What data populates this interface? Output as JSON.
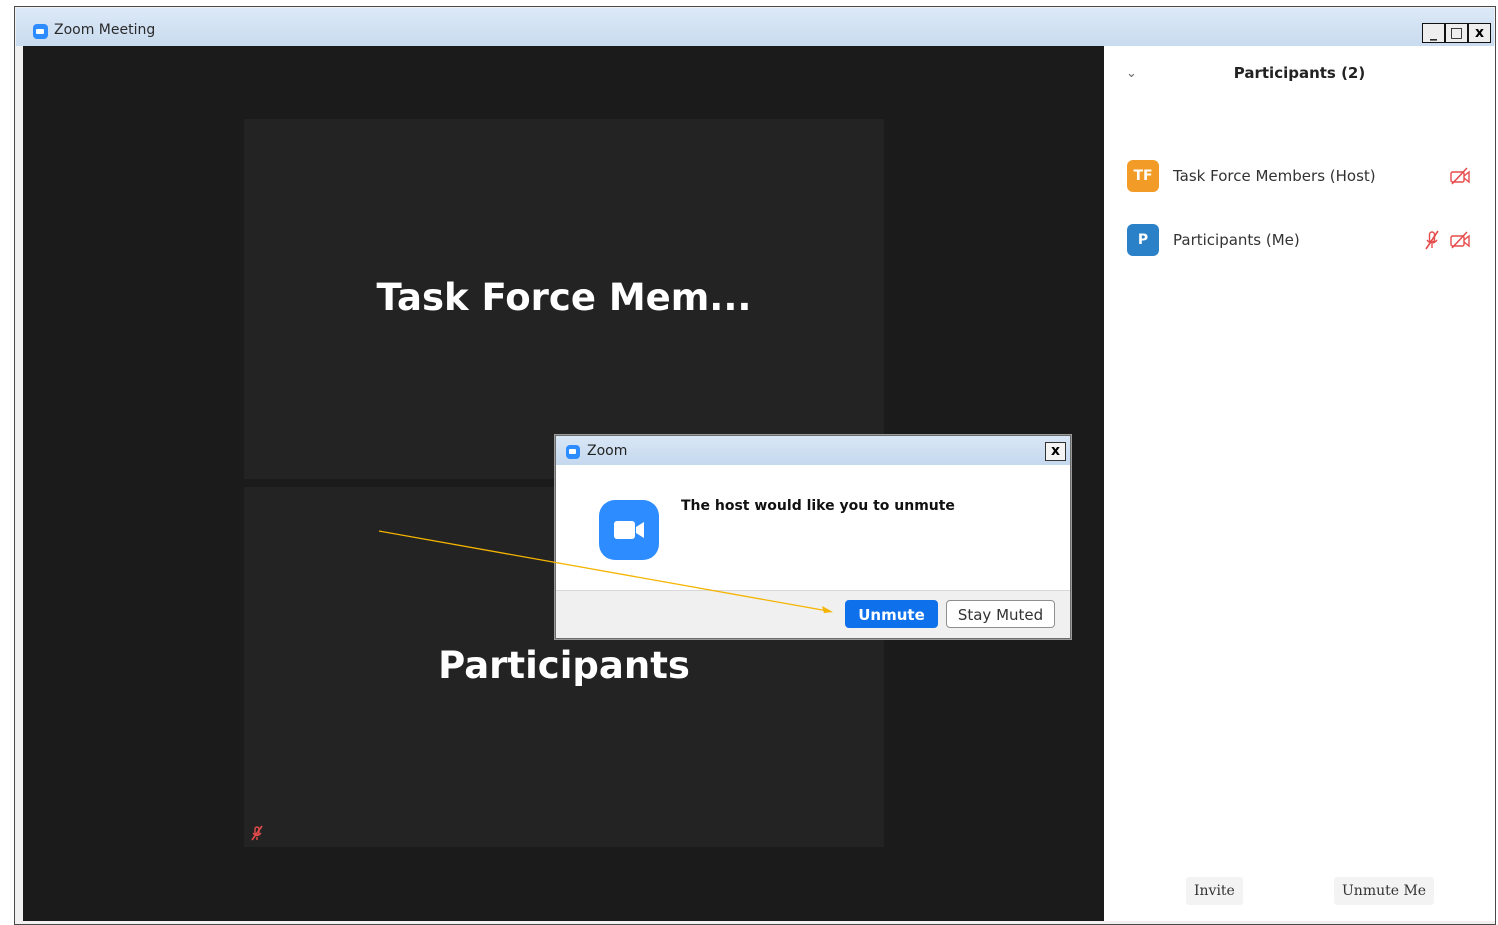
{
  "window": {
    "title": "Zoom Meeting",
    "controls": [
      "_",
      "□",
      "x"
    ]
  },
  "video": {
    "tiles": [
      {
        "name": "Task Force Mem..."
      },
      {
        "name": "Participants",
        "muted": true
      }
    ]
  },
  "panel": {
    "title": "Participants (2)",
    "participants": [
      {
        "initials": "TF",
        "name": "Task Force Members (Host)",
        "avatar_color": "#f29b26",
        "muted": false,
        "video_off": true
      },
      {
        "initials": "P",
        "name": "Participants (Me)",
        "avatar_color": "#2a81c7",
        "muted": true,
        "video_off": true
      }
    ],
    "invite_label": "Invite",
    "unmute_me_label": "Unmute Me"
  },
  "dialog": {
    "title": "Zoom",
    "close_label": "x",
    "message": "The host would like you to unmute",
    "unmute_label": "Unmute",
    "stay_muted_label": "Stay Muted"
  },
  "colors": {
    "accent": "#0e71eb",
    "brand": "#2d8cff",
    "muted_icon": "#e64b4b",
    "annotation_arrow": "#f5b400"
  }
}
